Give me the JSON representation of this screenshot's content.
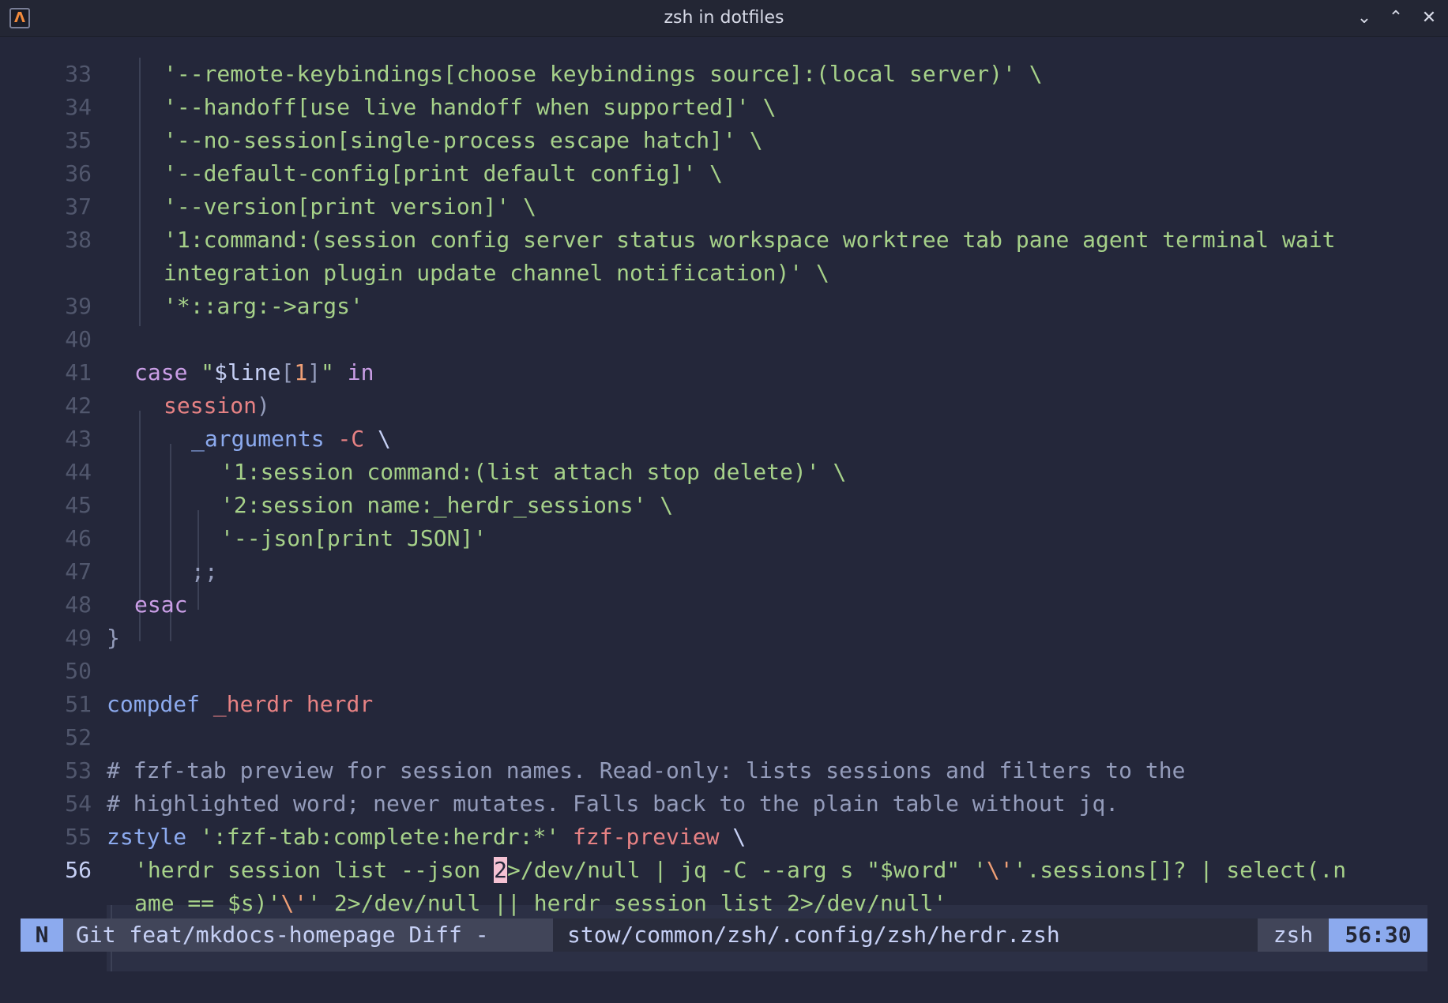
{
  "window": {
    "title": "zsh in dotfiles",
    "app_icon_glyph": "Λ"
  },
  "editor": {
    "lines": [
      {
        "n": "33",
        "code": "'--remote-keybindings[choose keybindings source]:(local server)' \\"
      },
      {
        "n": "34",
        "code": "'--handoff[use live handoff when supported]' \\"
      },
      {
        "n": "35",
        "code": "'--no-session[single-process escape hatch]' \\"
      },
      {
        "n": "36",
        "code": "'--default-config[print default config]' \\"
      },
      {
        "n": "37",
        "code": "'--version[print version]' \\"
      },
      {
        "n": "38",
        "code": "'1:command:(session config server status workspace worktree tab pane agent terminal wait",
        "wrap": "integration plugin update channel notification)' \\"
      },
      {
        "n": "39",
        "code": "'*::arg:->args'"
      },
      {
        "n": "40",
        "code": ""
      },
      {
        "n": "41",
        "code": "case \"$line[1]\" in"
      },
      {
        "n": "42",
        "code": "session)"
      },
      {
        "n": "43",
        "code": "_arguments -C \\"
      },
      {
        "n": "44",
        "code": "'1:session command:(list attach stop delete)' \\"
      },
      {
        "n": "45",
        "code": "'2:session name:_herdr_sessions' \\"
      },
      {
        "n": "46",
        "code": "'--json[print JSON]'"
      },
      {
        "n": "47",
        "code": ";;"
      },
      {
        "n": "48",
        "code": "esac"
      },
      {
        "n": "49",
        "code": "}"
      },
      {
        "n": "50",
        "code": ""
      },
      {
        "n": "51",
        "code": "compdef _herdr herdr"
      },
      {
        "n": "52",
        "code": ""
      },
      {
        "n": "53",
        "code": "# fzf-tab preview for session names. Read-only: lists sessions and filters to the"
      },
      {
        "n": "54",
        "code": "# highlighted word; never mutates. Falls back to the plain table without jq."
      },
      {
        "n": "55",
        "code": "zstyle ':fzf-tab:complete:herdr:*' fzf-preview \\"
      },
      {
        "n": "56",
        "code": "'herdr session list --json 2>/dev/null | jq -C --arg s \"$word\" '\\''.sessions[]? | select(.n",
        "wrap": "ame == $s)'\\'' 2>/dev/null || herdr session list 2>/dev/null'"
      }
    ]
  },
  "statusbar": {
    "mode": "N",
    "git": "Git feat/mkdocs-homepage Diff -",
    "file": "stow/common/zsh/.config/zsh/herdr.zsh",
    "filetype": "zsh",
    "position": "56:30"
  },
  "colors": {
    "background": "#24273a",
    "string": "#a6d189",
    "keyword": "#ca9ee6",
    "function": "#8caaee",
    "identifier": "#e78284",
    "comment": "#949cbb",
    "accent": "#8caaee"
  }
}
